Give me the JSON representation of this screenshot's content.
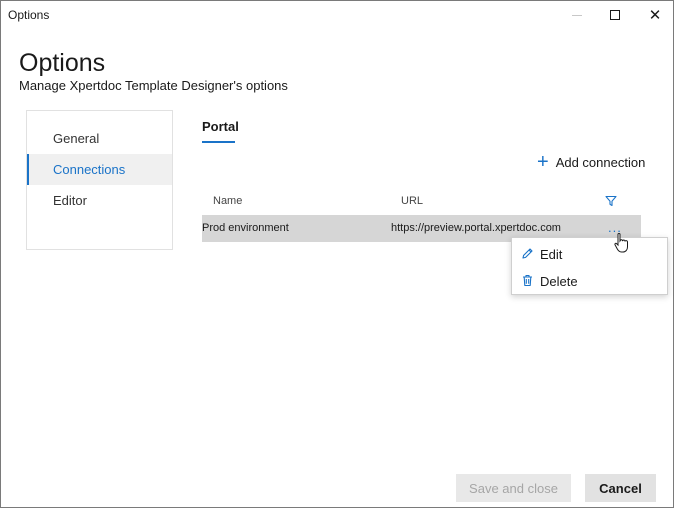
{
  "window": {
    "title": "Options",
    "minimize_icon": "minimize-icon",
    "maximize_icon": "maximize-icon",
    "close_icon": "close-icon"
  },
  "header": {
    "title": "Options",
    "subtitle": "Manage Xpertdoc Template Designer's options"
  },
  "nav": {
    "items": [
      {
        "label": "General",
        "active": false
      },
      {
        "label": "Connections",
        "active": true
      },
      {
        "label": "Editor",
        "active": false
      }
    ]
  },
  "main": {
    "tab": "Portal",
    "add_connection_label": "Add connection",
    "table": {
      "columns": [
        "Name",
        "URL"
      ],
      "rows": [
        {
          "name": "Prod environment",
          "url": "https://preview.portal.xpertdoc.com",
          "more": "..."
        }
      ]
    },
    "context_menu": {
      "items": [
        {
          "label": "Edit",
          "icon": "pencil-icon"
        },
        {
          "label": "Delete",
          "icon": "trash-icon"
        }
      ]
    }
  },
  "footer": {
    "save_label": "Save and close",
    "cancel_label": "Cancel"
  },
  "colors": {
    "accent": "#1a73c8",
    "selected_row": "#d6d6d6",
    "nav_active_bg": "#f0f0f0"
  }
}
